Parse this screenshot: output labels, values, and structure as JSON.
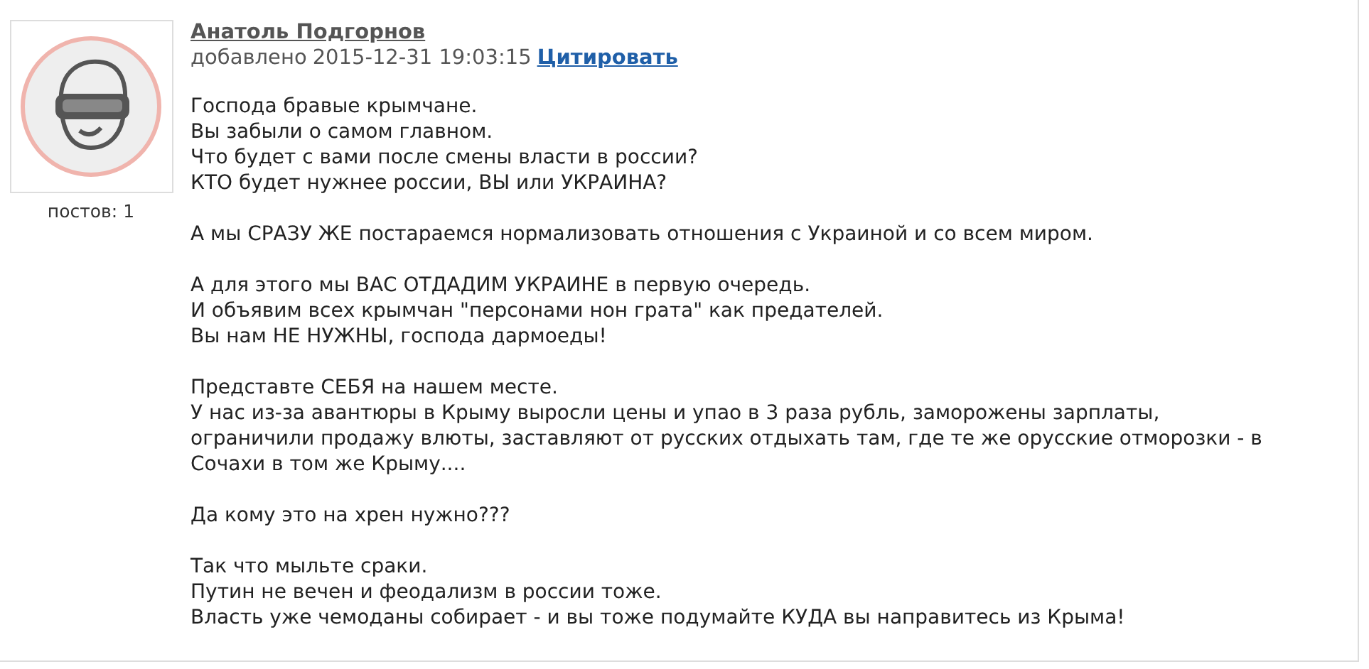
{
  "post": {
    "author": "Анатоль Подгорнов ",
    "added_label": "добавлено",
    "timestamp": "2015-12-31 19:03:15",
    "quote_link": "Цитировать",
    "post_count": "постов: 1",
    "paragraphs": [
      {
        "lines": [
          "Господа бравые крымчане.",
          "Вы забыли о самом главном.",
          "Что будет с вами после смены власти в россии?",
          "КТО будет нужнее россии, ВЫ или УКРАИНА?"
        ]
      },
      {
        "lines": [
          "А мы СРАЗУ ЖЕ постараемся нормализовать отношения с Украиной и со всем миром."
        ]
      },
      {
        "lines": [
          "А для этого мы ВАС ОТДАДИМ УКРАИНЕ в первую очередь.",
          "И объявим всех крымчан \"персонами нон грата\" как предателей.",
          "Вы нам НЕ НУЖНЫ, господа дармоеды!"
        ]
      },
      {
        "lines": [
          "Представте СЕБЯ на нашем месте.",
          "У нас из-за авантюры в Крыму выросли цены и упао в 3 раза рубль, заморожены зарплаты,",
          "ограничили продажу влюты, заставляют от русских отдыхать там, где те же орусские отморозки - в",
          "Сочахи в том же Крыму...."
        ]
      },
      {
        "lines": [
          "Да кому это на хрен нужно???"
        ]
      },
      {
        "lines": [
          "Так что мыльте сраки.",
          "Путин не вечен и феодализм в россии тоже.",
          "Власть уже чемоданы собирает - и вы тоже подумайте КУДА вы направитесь из Крыма!"
        ]
      }
    ]
  }
}
